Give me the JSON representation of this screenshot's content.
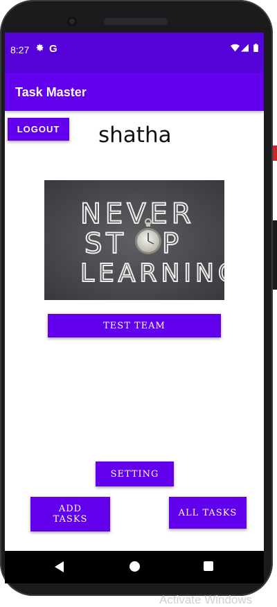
{
  "status_bar": {
    "time": "8:27",
    "settings_icon": "gear-icon",
    "google_icon": "G",
    "wifi_icon": "wifi-icon",
    "signal_icon": "signal-icon",
    "battery_icon": "battery-icon"
  },
  "app_bar": {
    "title": "Task Master"
  },
  "main": {
    "logout_label": "LOGOUT",
    "username": "shatha",
    "banner": {
      "line1": "NEVER",
      "line2a": "ST",
      "line2b": "P",
      "line3": "LEARNING"
    },
    "team_label": "TEST TEAM",
    "setting_label": "SETTING",
    "add_tasks_line1": "ADD",
    "add_tasks_line2": "TASKS",
    "all_tasks_label": "ALL TASKS"
  },
  "nav": {
    "back": "back-icon",
    "home": "home-icon",
    "recents": "recents-icon"
  },
  "overlay": {
    "watermark": "Activate Windows"
  },
  "colors": {
    "status_bar": "#5502d8",
    "primary": "#6200ee",
    "screen_bg": "#ffffff",
    "device": "#1b1b1d"
  }
}
